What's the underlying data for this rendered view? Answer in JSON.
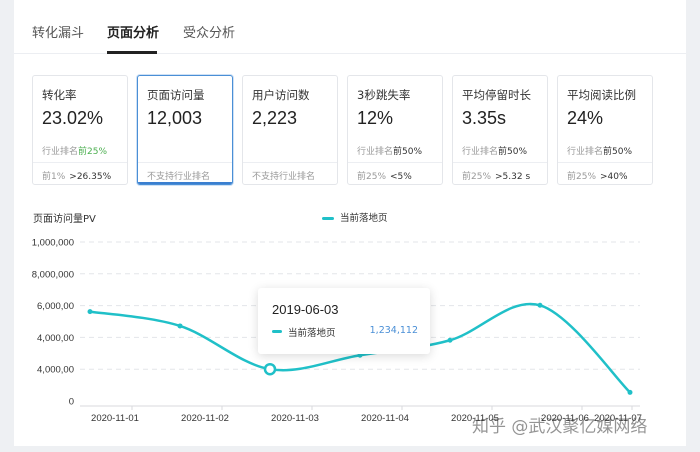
{
  "tabs": [
    {
      "label": "转化漏斗",
      "active": false
    },
    {
      "label": "页面分析",
      "active": true
    },
    {
      "label": "受众分析",
      "active": false
    }
  ],
  "cards": [
    {
      "title": "转化率",
      "value": "23.02%",
      "rank_prefix": "行业排名",
      "rank_value": "前25%",
      "foot_label": "前1%",
      "foot_value": ">26.35%"
    },
    {
      "title": "页面访问量",
      "value": "12,003",
      "selected": true,
      "foot_label": "不支持行业排名"
    },
    {
      "title": "用户访问数",
      "value": "2,223",
      "foot_label": "不支持行业排名"
    },
    {
      "title": "3秒跳失率",
      "value": "12%",
      "rank_prefix": "行业排名",
      "rank_value": "前50%",
      "foot_label": "前25%",
      "foot_value": "<5%"
    },
    {
      "title": "平均停留时长",
      "value": "3.35s",
      "rank_prefix": "行业排名",
      "rank_value": "前50%",
      "foot_label": "前25%",
      "foot_value": ">5.32 s"
    },
    {
      "title": "平均阅读比例",
      "value": "24%",
      "rank_prefix": "行业排名",
      "rank_value": "前50%",
      "foot_label": "前25%",
      "foot_value": ">40%"
    }
  ],
  "colors": {
    "accent": "#20c0c8",
    "selected_border": "#3a7fd0",
    "rank_green": "#4caf50",
    "tooltip_value": "#4a8fd6"
  },
  "chart_data": {
    "type": "line",
    "title": "页面访问量PV",
    "legend": "top-center",
    "grid": true,
    "y_tick_labels": [
      "1,000,000",
      "8,000,000",
      "6,000,00",
      "4,000,00",
      "4,000,00",
      "0"
    ],
    "categories": [
      "2020-11-01",
      "2020-11-02",
      "2020-11-03",
      "2020-11-04",
      "2020-11-05",
      "2020-11-06",
      "2020-11-07"
    ],
    "x_tick_labels": [
      "2020-11-01",
      "2020-11-02",
      "2020-11-03",
      "2020-11-04",
      "2020-11-05",
      "2020-11-06",
      "2020-11-07"
    ],
    "series": [
      {
        "name": "当前落地页",
        "values_tick_units": [
          2.81,
          2.36,
          1.0,
          1.44,
          1.91,
          3.01,
          0.27
        ]
      }
    ],
    "y_tick_count": 6,
    "highlight_index": 2,
    "tooltip": {
      "title": "2019-06-03",
      "series_label": "当前落地页",
      "value": "1,234,112"
    }
  },
  "watermark": "知乎 @武汉聚亿媒网络"
}
